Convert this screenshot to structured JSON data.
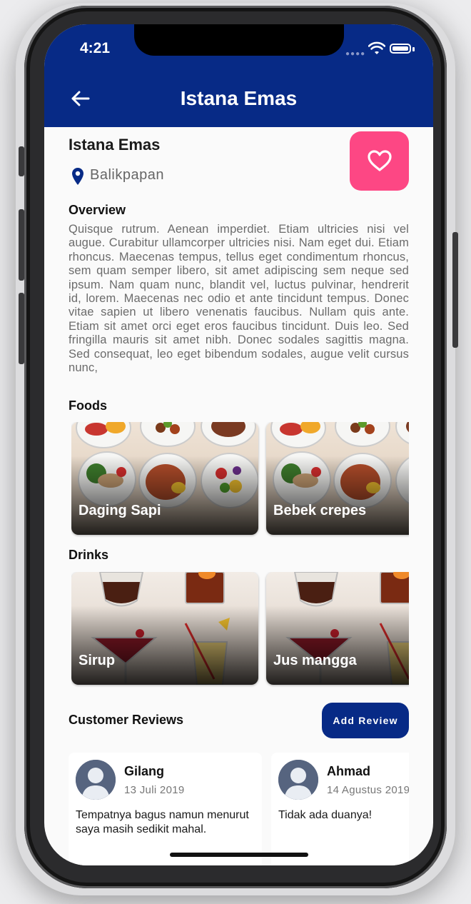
{
  "status_bar": {
    "time": "4:21"
  },
  "appbar": {
    "title": "Istana Emas"
  },
  "restaurant": {
    "name": "Istana Emas",
    "location": "Balikpapan"
  },
  "overview": {
    "title": "Overview",
    "text": "Quisque rutrum. Aenean imperdiet. Etiam ultricies nisi vel augue. Curabitur ullamcorper ultricies nisi. Nam eget dui. Etiam rhoncus. Maecenas tempus, tellus eget condimentum rhoncus, sem quam semper libero, sit amet adipiscing sem neque sed ipsum. Nam quam nunc, blandit vel, luctus pulvinar, hendrerit id, lorem. Maecenas nec odio et ante tincidunt tempus. Donec vitae sapien ut libero venenatis faucibus. Nullam quis ante. Etiam sit amet orci eget eros faucibus tincidunt. Duis leo. Sed fringilla mauris sit amet nibh. Donec sodales sagittis magna. Sed consequat, leo eget bibendum sodales, augue velit cursus nunc,"
  },
  "foods": {
    "title": "Foods",
    "items": [
      {
        "label": "Daging Sapi"
      },
      {
        "label": "Bebek crepes"
      }
    ]
  },
  "drinks": {
    "title": "Drinks",
    "items": [
      {
        "label": "Sirup"
      },
      {
        "label": "Jus mangga"
      }
    ]
  },
  "reviews": {
    "title": "Customer Reviews",
    "add_label": "Add Review",
    "items": [
      {
        "name": "Gilang",
        "date": "13 Juli 2019",
        "text": "Tempatnya bagus namun menurut saya masih sedikit mahal."
      },
      {
        "name": "Ahmad",
        "date": "14 Agustus 2019",
        "text": "Tidak ada duanya!"
      }
    ]
  },
  "colors": {
    "appbar": "#072a86",
    "favorite": "#fd4784",
    "add_review": "#072a86"
  },
  "icons": {
    "back": "arrow-left-icon",
    "location": "map-pin-icon",
    "favorite": "heart-outline-icon",
    "avatar": "person-silhouette-icon"
  }
}
